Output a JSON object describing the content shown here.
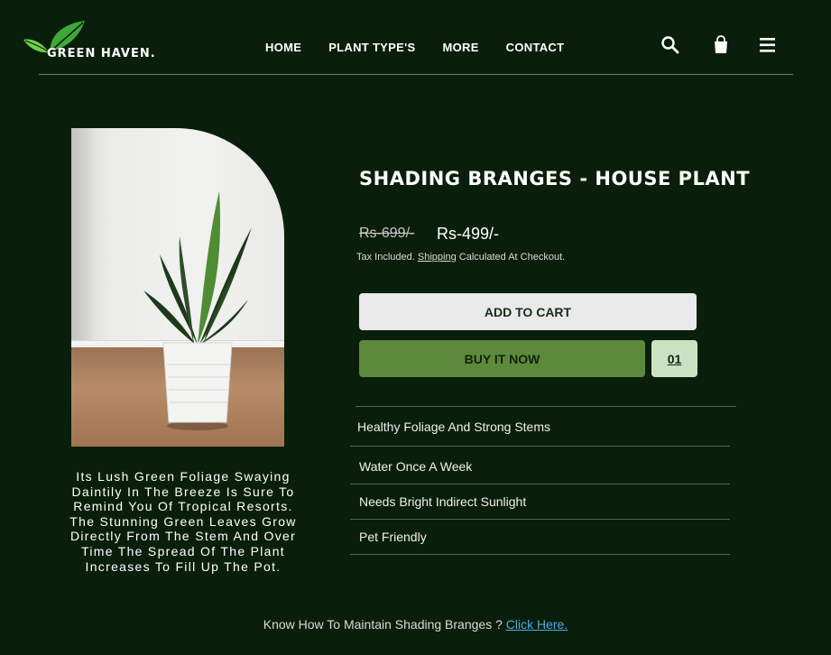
{
  "header": {
    "logo_text": "GREEN HAVEN.",
    "nav": [
      "HOME",
      "PLANT TYPE'S",
      "MORE",
      "CONTACT"
    ],
    "icons": [
      "search-icon",
      "shopping-bag-icon",
      "menu-icon"
    ]
  },
  "product": {
    "title": "SHADING BRANGES - HOUSE PLANT",
    "price_old": "Rs-699/-",
    "price_new": "Rs-499/-",
    "tax_prefix": "Tax Included.",
    "tax_link": "Shipping",
    "tax_suffix": "Calculated At Checkout.",
    "add_to_cart": "ADD TO CART",
    "buy_now": "BUY IT NOW",
    "quantity": "01",
    "description": "Its Lush Green Foliage Swaying Daintily In The Breeze Is Sure To Remind You Of Tropical Resorts. The Stunning Green Leaves Grow Directly From The Stem And Over Time The Spread Of The Plant Increases To Fill Up The Pot.",
    "features": [
      "Healthy Foliage And Strong Stems",
      "Water Once A Week",
      "Needs Bright Indirect Sunlight",
      "Pet Friendly"
    ]
  },
  "footer": {
    "note": "Know How To Maintain Shading Branges ?",
    "link": "Click Here."
  },
  "colors": {
    "background": "#0a1f0b",
    "buy_button": "#5c8a3a",
    "cart_button": "#e9eae9",
    "quantity_box": "#c9e3c2",
    "link": "#4da8e6"
  }
}
